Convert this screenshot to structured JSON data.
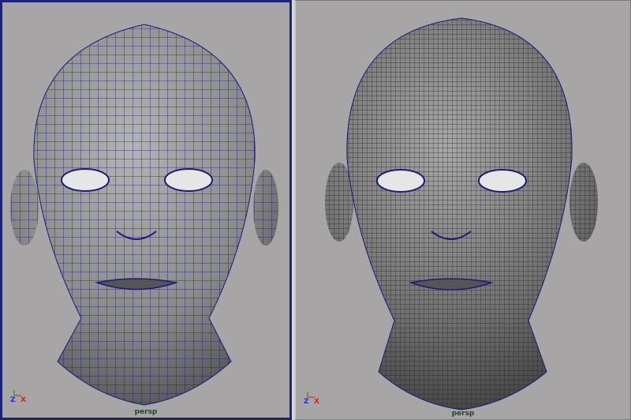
{
  "viewports": [
    {
      "id": "left",
      "camera": "persp",
      "axis": {
        "z": "Z",
        "x": "X"
      },
      "wire_density": "low",
      "active": true
    },
    {
      "id": "right",
      "camera": "persp",
      "axis": {
        "z": "Z",
        "x": "X"
      },
      "wire_density": "high",
      "active": false
    }
  ],
  "colors": {
    "background": "#a8a5a7",
    "active_border": "#1d2478",
    "wireframe": "#1a1a7a",
    "shading_light": "#9c9c9c",
    "shading_dark": "#3e3e3e",
    "axis_z": "#2233cc",
    "axis_x": "#cc2222",
    "camera_label": "#1f4a1f"
  }
}
